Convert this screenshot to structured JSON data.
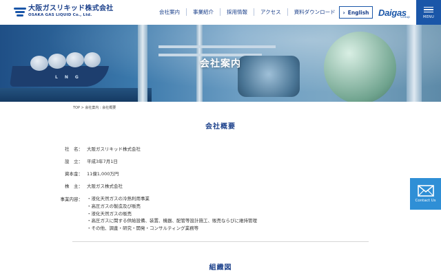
{
  "header": {
    "logo_jp": "大阪ガスリキッド株式会社",
    "logo_en": "OSAKA GAS LIQUID Co., Ltd.",
    "nav": [
      {
        "label": "会社案内"
      },
      {
        "label": "事業紹介"
      },
      {
        "label": "採用情報"
      },
      {
        "label": "アクセス"
      },
      {
        "label": "資料ダウンロード"
      }
    ],
    "english_label": "English",
    "brand_word": "Daigas",
    "brand_sub": "Group",
    "menu_label": "MENU",
    "brand_color": "#1a56a8"
  },
  "hero": {
    "title": "会社案内",
    "ship_lettering": "LNG"
  },
  "breadcrumb": "TOP > 会社案内 : 会社概要",
  "overview": {
    "heading": "会社概要",
    "rows": [
      {
        "label": "社　名",
        "value": "大阪ガスリキッド株式会社"
      },
      {
        "label": "設　立",
        "value": "平成3年7月1日"
      },
      {
        "label": "資本金",
        "value": "11億1,000万円"
      },
      {
        "label": "株　主",
        "value": "大阪ガス株式会社"
      }
    ],
    "business_label": "事業内容",
    "business_items": [
      "・液化天然ガスの冷熱利用事業",
      "・高圧ガスの製造及び販売",
      "・液化天然ガスの販売",
      "・高圧ガスに関する供給設備、装置、機器、配管等設計施工、販売ならびに維持管理",
      "・その他、調査・研究・開発・コンサルティング業務等"
    ]
  },
  "org_heading": "組織図",
  "contact": {
    "label": "Contact Us",
    "color": "#2f8fd6"
  }
}
